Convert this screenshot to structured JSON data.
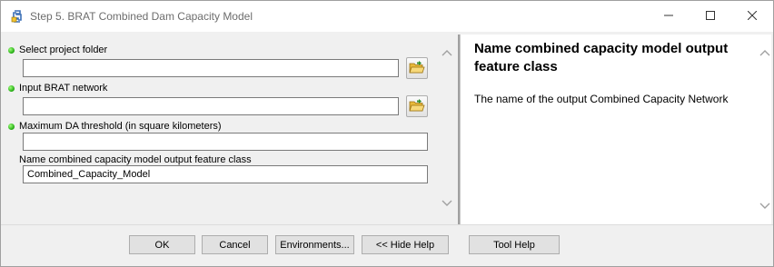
{
  "window": {
    "title": "Step 5. BRAT Combined Dam Capacity Model",
    "icons": {
      "app": "python-script-icon",
      "minimize": "minimize-icon",
      "maximize": "maximize-icon",
      "close": "close-icon"
    }
  },
  "form": {
    "fields": [
      {
        "label": "Select project folder",
        "value": "",
        "required": true,
        "browse": true
      },
      {
        "label": "Input BRAT network",
        "value": "",
        "required": true,
        "browse": true
      },
      {
        "label": "Maximum DA threshold (in square kilometers)",
        "value": "",
        "required": true,
        "browse": false
      },
      {
        "label": "Name combined capacity model output feature class",
        "value": "Combined_Capacity_Model",
        "required": false,
        "browse": false
      }
    ],
    "browse_icon": "open-folder-icon",
    "required_marker_color": "#1fa80f"
  },
  "help": {
    "title": "Name combined capacity model output feature class",
    "body": "The name of the output Combined Capacity Network"
  },
  "buttons": {
    "ok": "OK",
    "cancel": "Cancel",
    "environments": "Environments...",
    "hide_help": "<< Hide Help",
    "tool_help": "Tool Help"
  }
}
